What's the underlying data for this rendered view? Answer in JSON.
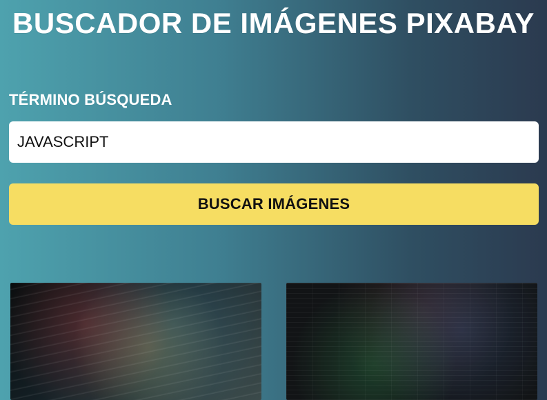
{
  "header": {
    "title": "BUSCADOR DE IMÁGENES PIXABAY"
  },
  "search": {
    "label": "TÉRMINO BÚSQUEDA",
    "value": "JAVASCRIPT",
    "placeholder": ""
  },
  "actions": {
    "search_button_label": "BUSCAR IMÁGENES"
  },
  "results": {
    "thumbnails": [
      {
        "name": "result-image-1"
      },
      {
        "name": "result-image-2"
      }
    ]
  },
  "colors": {
    "button_bg": "#f6dd62",
    "background_gradient_start": "#4ea2ae",
    "background_gradient_end": "#2b3a4f"
  }
}
